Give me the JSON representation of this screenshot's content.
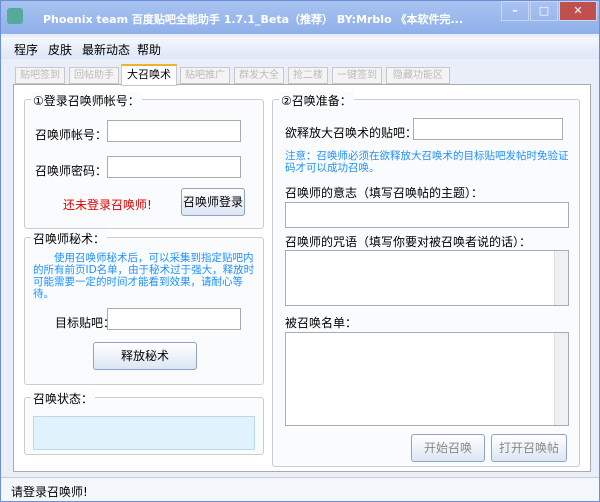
{
  "window": {
    "title": "Phoenix team 百度贴吧全能助手 1.7.1_Beta（推荐） BY:Mrblo 《本软件完..."
  },
  "menu": [
    "程序",
    "皮肤",
    "最新动态",
    "帮助"
  ],
  "tabs": [
    {
      "label": "贴吧签到",
      "active": false
    },
    {
      "label": "回帖助手",
      "active": false
    },
    {
      "label": "大召唤术",
      "active": true
    },
    {
      "label": "贴吧推广",
      "active": false
    },
    {
      "label": "群发大全",
      "active": false
    },
    {
      "label": "抢二楼",
      "active": false
    },
    {
      "label": "一键签到",
      "active": false
    },
    {
      "label": "隐藏功能区",
      "active": false
    }
  ],
  "login": {
    "legend": "①登录召唤师帐号：",
    "account_label": "召唤师帐号：",
    "password_label": "召唤师密码：",
    "status": "还未登录召唤师!",
    "login_button": "召唤师登录"
  },
  "secret": {
    "legend": "召唤师秘术：",
    "desc": "使用召唤师秘术后，可以采集到指定贴吧内的所有前页ID名单，由于秘术过于强大，释放时可能需要一定的时间才能看到效果，请耐心等待。",
    "target_label": "目标贴吧：",
    "release_button": "释放秘术"
  },
  "summon_status": {
    "legend": "召唤状态："
  },
  "prepare": {
    "legend": "②召唤准备：",
    "bar_label": "欲释放大召唤术的贴吧：",
    "note": "注意：召唤师必须在欲释放大召唤术的目标贴吧发帖时免验证码才可以成功召唤。",
    "will_label": "召唤师的意志（填写召唤帖的主题）：",
    "spell_label": "召唤师的咒语（填写你要对被召唤者说的话）：",
    "list_label": "被召唤名单：",
    "start_button": "开始召唤",
    "open_button": "打开召唤帖"
  },
  "statusbar": {
    "text": "请登录召唤师!"
  },
  "colors": {
    "accent_blue": "#1e90ff",
    "warning_red": "#e00000"
  }
}
